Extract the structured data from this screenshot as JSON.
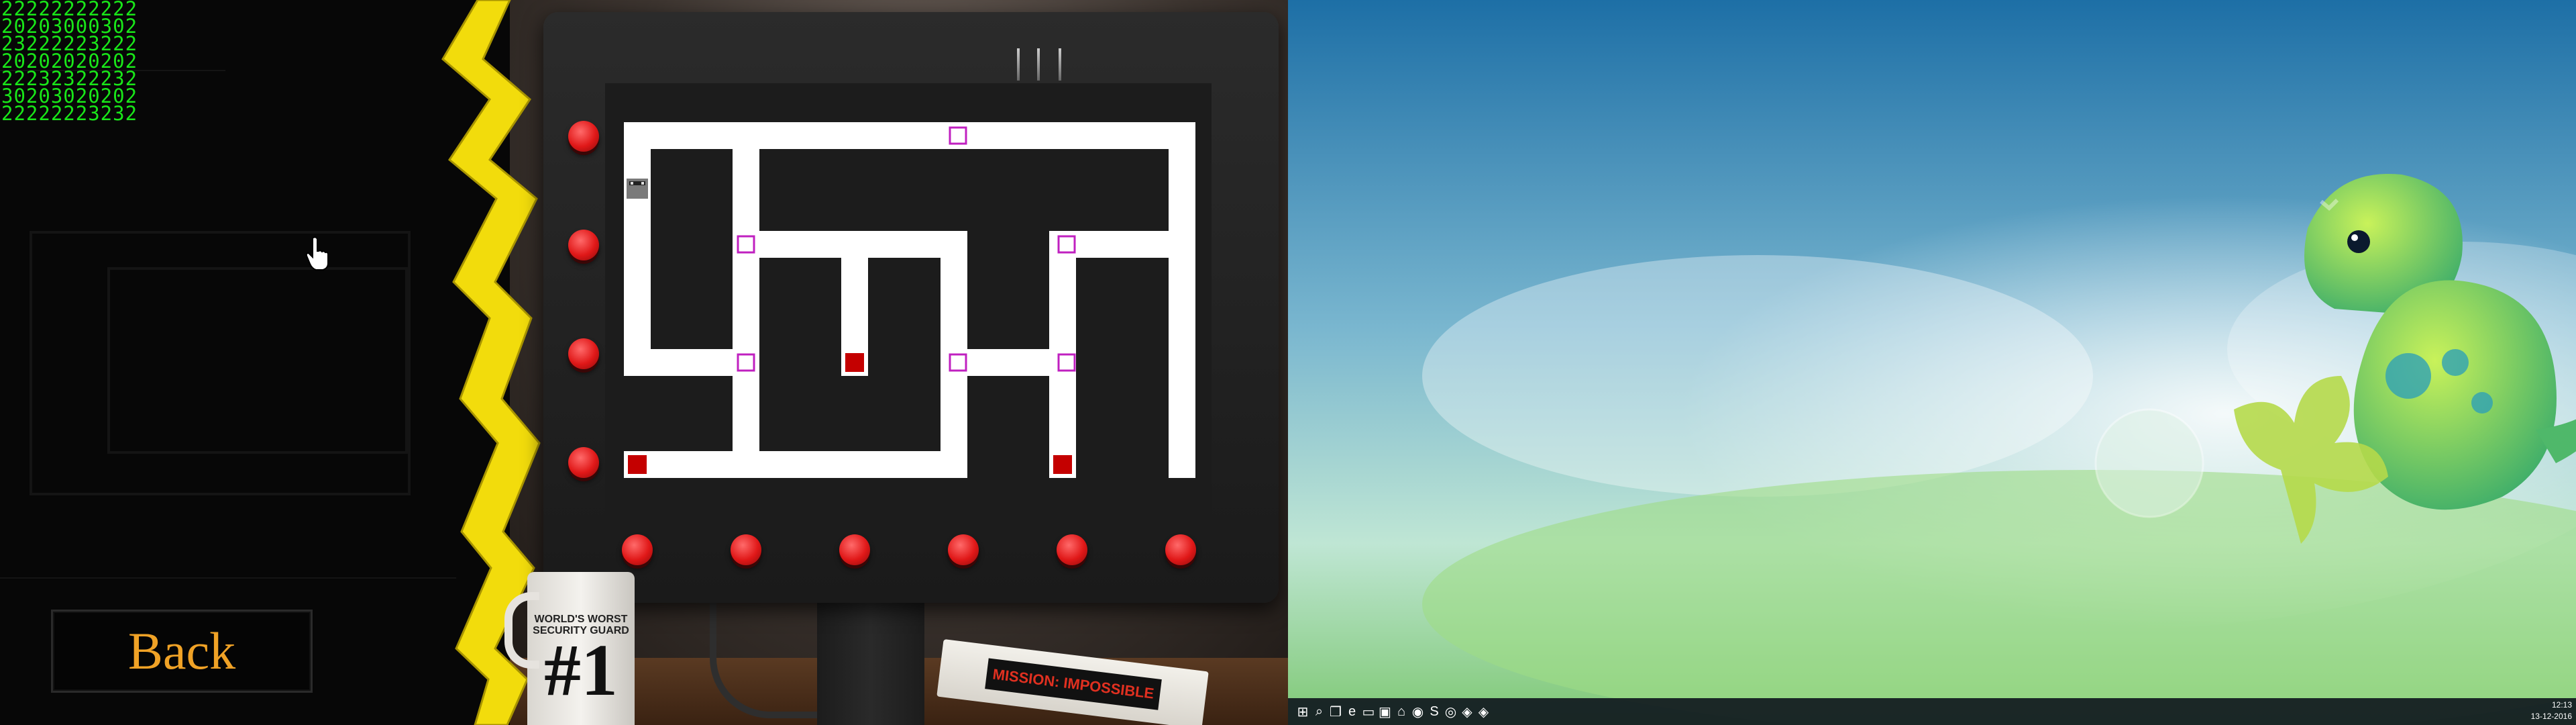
{
  "game": {
    "code_grid": [
      "22222222222",
      "20203000302",
      "23222223222",
      "20202020202",
      "22232322232",
      "30203020202",
      "22222223232"
    ],
    "back_label": "Back",
    "mug_caption": "WORLD'S WORST SECURITY GUARD",
    "mug_number": "#1",
    "vhs_title": "MISSION: IMPOSSIBLE",
    "colors": {
      "code_text": "#19e619",
      "back_text": "#f0a226",
      "bolt": "#f2dc0c",
      "maze_path": "#ffffff",
      "maze_wall": "#1c1c1c",
      "gate": "#c020c0",
      "hazard": "#c40000",
      "button": "#e01818"
    }
  },
  "desktop": {
    "taskbar_icons": [
      {
        "name": "windows-start-icon",
        "glyph": "⊞"
      },
      {
        "name": "search-icon",
        "glyph": "⌕"
      },
      {
        "name": "task-view-icon",
        "glyph": "❐"
      },
      {
        "name": "edge-browser-icon",
        "glyph": "e"
      },
      {
        "name": "file-explorer-icon",
        "glyph": "▭"
      },
      {
        "name": "store-icon",
        "glyph": "▣"
      },
      {
        "name": "home-icon",
        "glyph": "⌂"
      },
      {
        "name": "firefox-icon",
        "glyph": "◉"
      },
      {
        "name": "skype-icon",
        "glyph": "S"
      },
      {
        "name": "chrome-icon",
        "glyph": "◎"
      },
      {
        "name": "nvidia-icon",
        "glyph": "◈"
      },
      {
        "name": "nvidia-active-icon",
        "glyph": "◈"
      }
    ],
    "clock_time": "12:13",
    "clock_date": "13-12-2016"
  }
}
